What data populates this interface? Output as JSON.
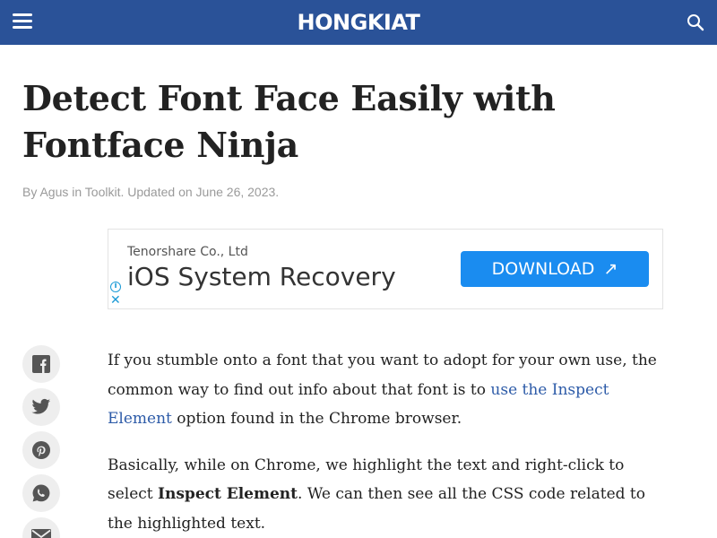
{
  "header": {
    "logo": "HONGKIAT",
    "menu_icon": "hamburger-menu-icon",
    "search_icon": "search-icon",
    "background": "#2a5298"
  },
  "article": {
    "title": "Detect Font Face Easily with Fontface Ninja",
    "byline": "By Agus in Toolkit. Updated on June 26, 2023."
  },
  "ad": {
    "company": "Tenorshare Co., Ltd",
    "product": "iOS System Recovery",
    "button_label": "DOWNLOAD",
    "button_arrow": "↗",
    "info_icon": "i",
    "close_icon": "✕",
    "button_color": "#1a8cf0"
  },
  "social": [
    "facebook-icon",
    "twitter-icon",
    "pinterest-icon",
    "whatsapp-icon",
    "email-icon"
  ],
  "body": {
    "p1_before": "If you stumble onto a font that you want to adopt for your own use, the common way to find out info about that font is to ",
    "p1_link": "use the Inspect Element",
    "p1_after": " option found in the Chrome browser.",
    "p2_before": "Basically, while on Chrome, we highlight the text and right-click to select ",
    "p2_bold": "Inspect Element",
    "p2_after": ". We can then see all the CSS code related to the highlighted text."
  }
}
